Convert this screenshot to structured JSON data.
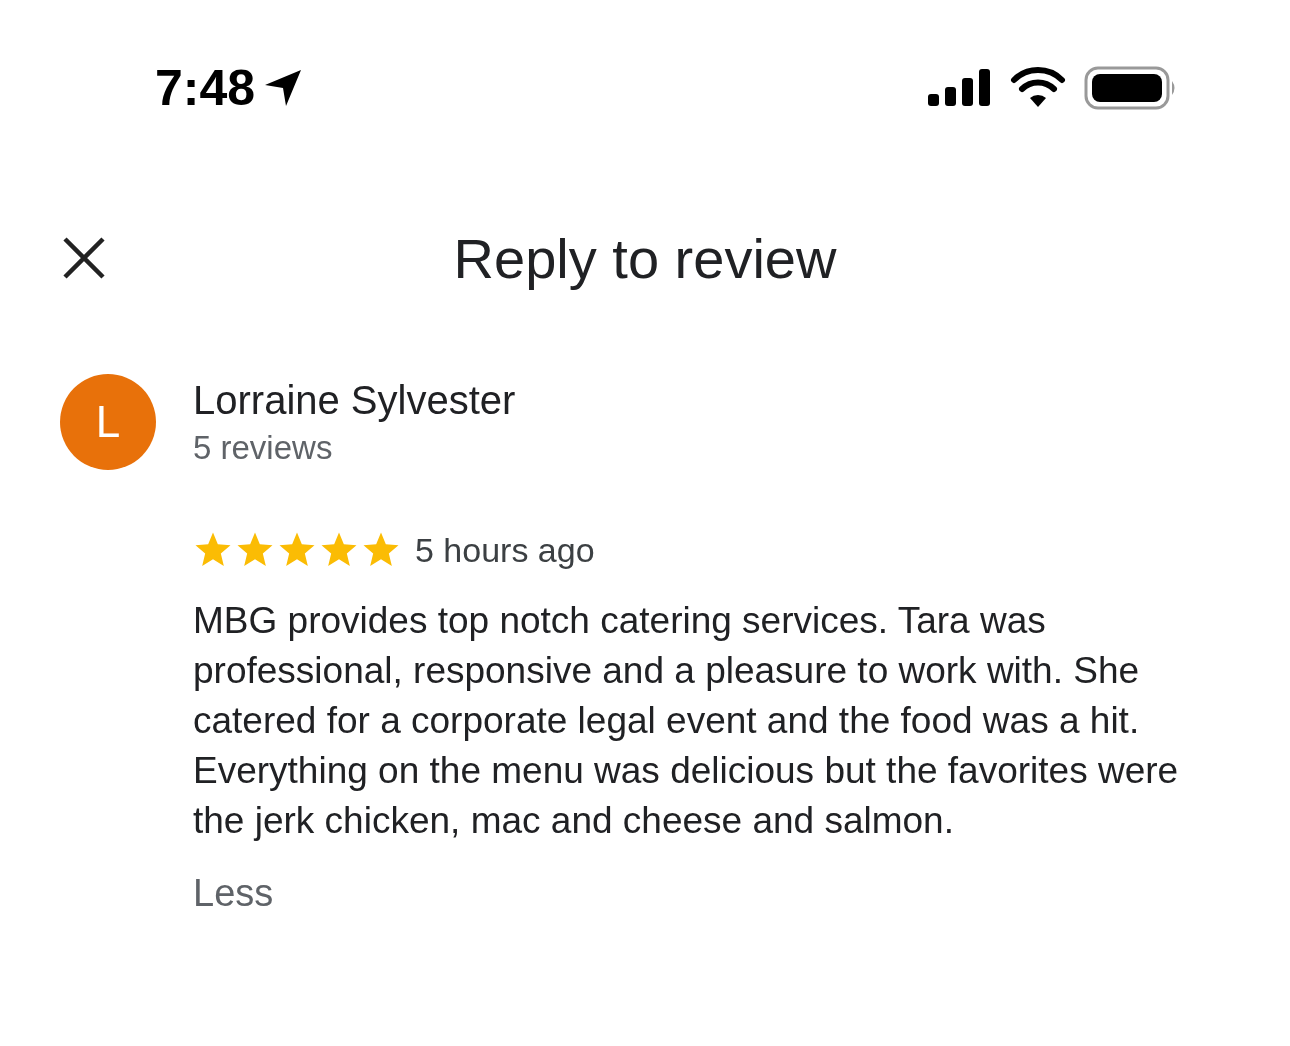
{
  "status_bar": {
    "time": "7:48"
  },
  "header": {
    "title": "Reply to review"
  },
  "review": {
    "avatar_letter": "L",
    "author": "Lorraine Sylvester",
    "author_reviews": "5 reviews",
    "stars": 5,
    "time": "5 hours ago",
    "text": "MBG provides top notch catering services. Tara was professional, responsive and a pleasure to work with. She catered for a corporate legal event and the food was a hit. Everything on the menu was delicious but the favorites were the jerk chicken, mac and cheese and salmon.",
    "toggle": "Less"
  }
}
